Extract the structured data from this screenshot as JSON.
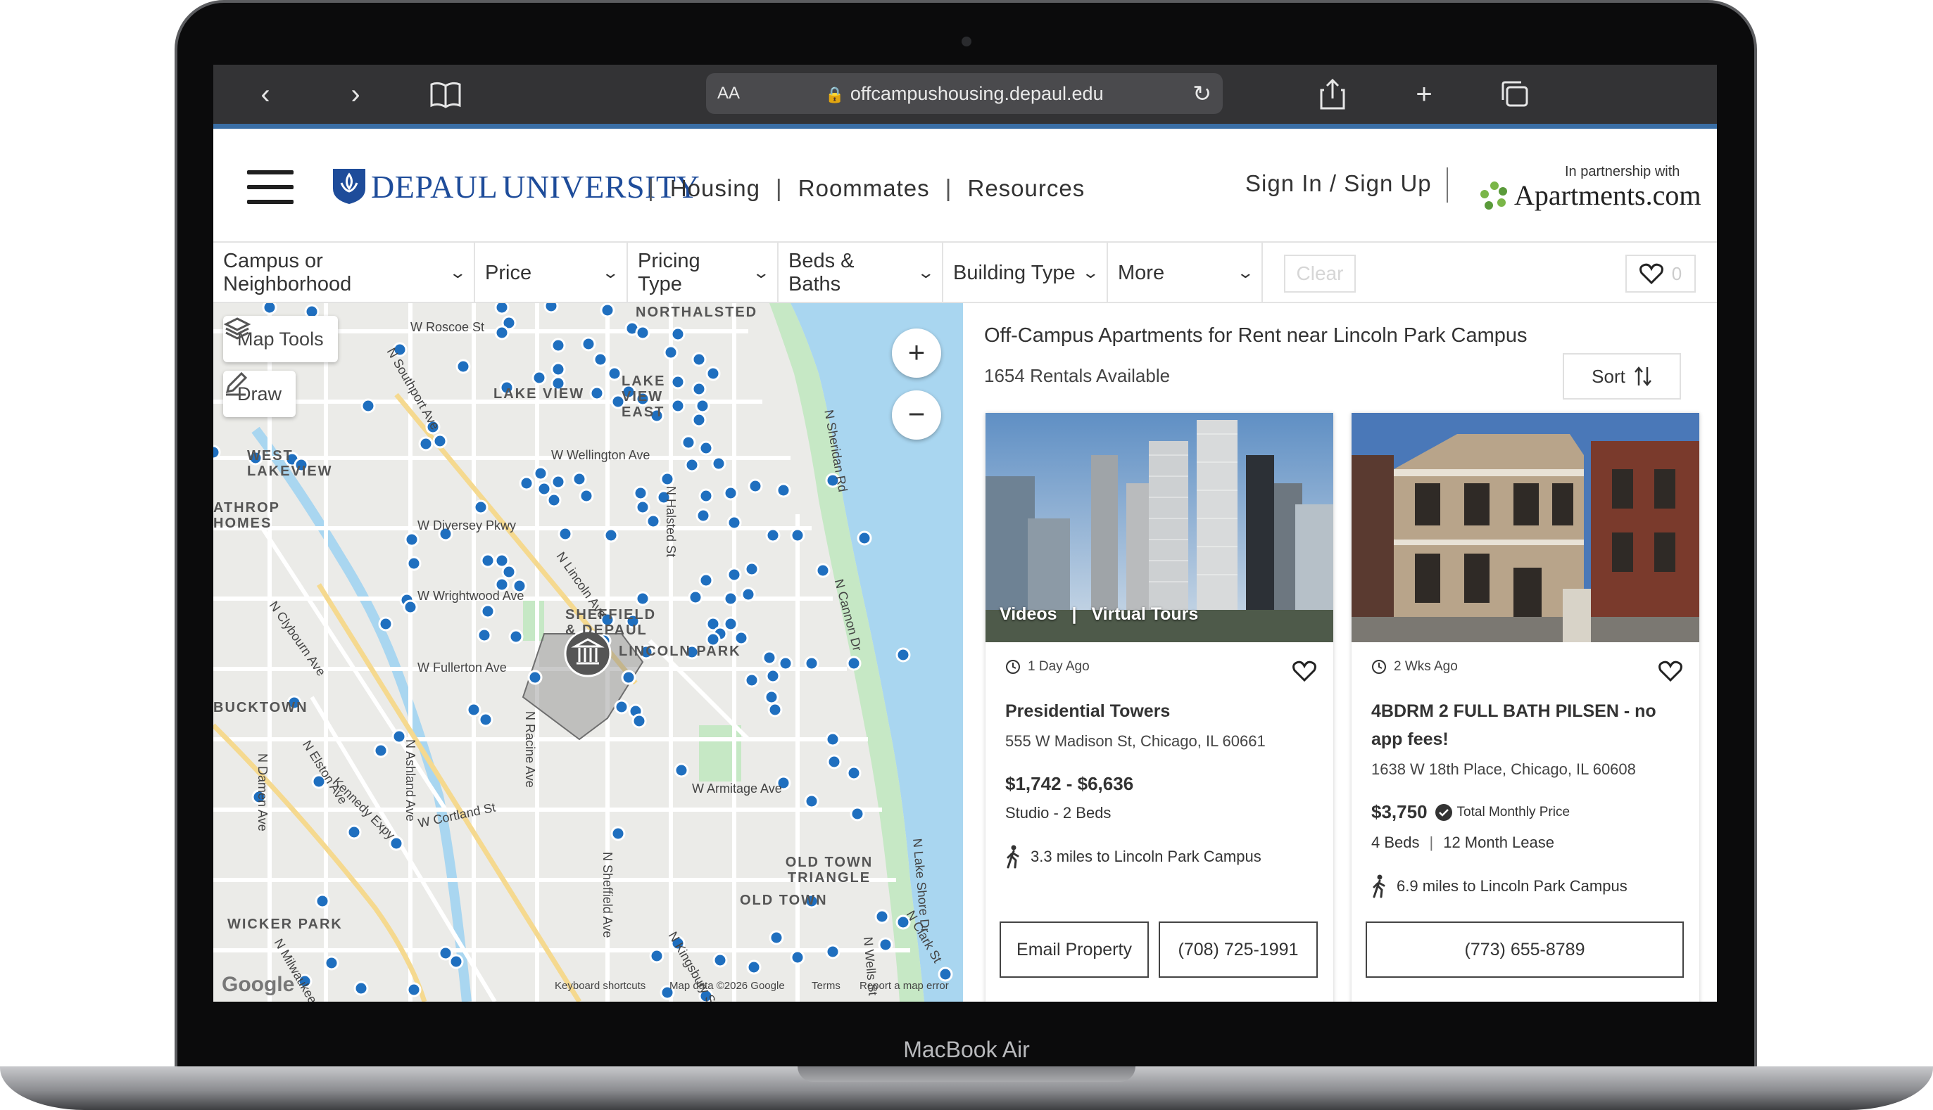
{
  "device": {
    "model_label": "MacBook Air"
  },
  "browser": {
    "aa_label": "AA",
    "url": "offcampushousing.depaul.edu",
    "icons": [
      "back-icon",
      "forward-icon",
      "bookmarks-icon",
      "lock-icon",
      "reload-icon",
      "share-icon",
      "new-tab-icon",
      "tabs-icon"
    ]
  },
  "header": {
    "logo_first": "DEPAUL",
    "logo_second": "UNIVERSITY",
    "nav": [
      "Housing",
      "Roommates",
      "Resources"
    ],
    "signin": "Sign In / Sign Up",
    "partner_label": "In partnership with",
    "partner_name": "Apartments.com"
  },
  "filters": {
    "items": [
      "Campus or Neighborhood",
      "Price",
      "Pricing Type",
      "Beds & Baths",
      "Building Type",
      "More"
    ],
    "clear": "Clear",
    "favorites_count": "0"
  },
  "map": {
    "tools": [
      "Map Tools",
      "Draw"
    ],
    "zoom_in": "+",
    "zoom_out": "−",
    "neighborhoods": [
      "LAKE VIEW",
      "WEST LAKEVIEW",
      "SHEFFIELD & DEPAUL",
      "LINCOLN PARK",
      "BUCKTOWN",
      "OLD TOWN TRIANGLE",
      "OLD TOWN",
      "WICKER PARK",
      "NORTHALSTED",
      "LAKE VIEW EAST",
      "ATHROP HOMES"
    ],
    "streets": [
      "W Roscoe St",
      "W Wellington Ave",
      "W Diversey Pkwy",
      "W Wrightwood Ave",
      "W Fullerton Ave",
      "W Armitage Ave",
      "W Cortland St",
      "Kennedy Expy",
      "N Clybourn Ave",
      "N Elston Ave",
      "N Halsted St",
      "N Sheffield Ave",
      "N Lincoln Ave",
      "N Racine Ave",
      "N Ashland Ave",
      "N Damen Ave",
      "N Sheridan Rd",
      "N Lake Shore Dr",
      "N Clark St",
      "N Cannon Dr",
      "N Kingsbury St",
      "N Wells St",
      "N Milwaukee Ave",
      "N Southport Ave"
    ],
    "footer": [
      "Keyboard shortcuts",
      "Map data ©2026 Google",
      "Terms",
      "Report a map error"
    ],
    "google_label": "Google"
  },
  "listings": {
    "title": "Off-Campus Apartments for Rent near Lincoln Park Campus",
    "count": "1654 Rentals Available",
    "sort_label": "Sort",
    "cards": [
      {
        "age": "1 Day Ago",
        "name": "Presidential Towers",
        "address": "555 W Madison St, Chicago, IL 60661",
        "price": "$1,742 - $6,636",
        "beds": "Studio - 2 Beds",
        "distance": "3.3 miles to Lincoln Park Campus",
        "media_tags": [
          "Videos",
          "Virtual Tours"
        ],
        "email_button": "Email Property",
        "phone": "(708) 725-1991"
      },
      {
        "age": "2 Wks Ago",
        "name": "4BDRM 2 FULL BATH PILSEN - no app fees!",
        "address": "1638 W 18th Place, Chicago, IL 60608",
        "price": "$3,750",
        "price_badge": "Total Monthly Price",
        "beds": "4 Beds",
        "lease": "12 Month Lease",
        "distance": "6.9 miles to Lincoln Park Campus",
        "phone": "(773) 655-8789"
      }
    ]
  },
  "colors": {
    "brand_blue": "#1e4c9a",
    "accent_bar": "#3a6ea5",
    "map_pin": "#1f6fbf",
    "water": "#a9d6f0",
    "park": "#c6e8c5"
  }
}
